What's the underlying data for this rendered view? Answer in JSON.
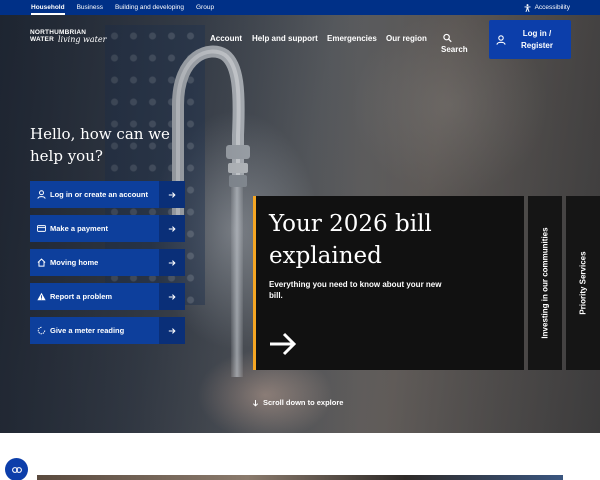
{
  "topbar": {
    "links": [
      "Household",
      "Business",
      "Building and developing",
      "Group"
    ],
    "active": "Household",
    "accessibility_label": "Accessibility"
  },
  "brand": {
    "logo_line1": "NORTHUMBRIAN",
    "logo_line2": "WATER",
    "logo_tagline": "living water"
  },
  "nav": {
    "items": [
      "Account",
      "Help and support",
      "Emergencies",
      "Our region"
    ],
    "search_label": "Search",
    "login_label": "Log in / Register"
  },
  "hero": {
    "greeting": "Hello, how can we help you?"
  },
  "quick_actions": [
    {
      "label": "Log in or create an account",
      "icon": "person-icon"
    },
    {
      "label": "Make a payment",
      "icon": "card-icon"
    },
    {
      "label": "Moving home",
      "icon": "home-icon"
    },
    {
      "label": "Report a problem",
      "icon": "warning-icon"
    },
    {
      "label": "Give a meter reading",
      "icon": "meter-icon"
    }
  ],
  "feature": {
    "title": "Your 2026 bill explained",
    "subtitle": "Everything you need to know about your new bill."
  },
  "side_cards": [
    "Investing in our communities",
    "Priority Services"
  ],
  "scroll_label": "Scroll down to explore",
  "colors": {
    "brand_blue": "#003087",
    "button_blue": "#0d3f9c",
    "accent_orange": "#f5a623",
    "card_dark": "#111111"
  }
}
